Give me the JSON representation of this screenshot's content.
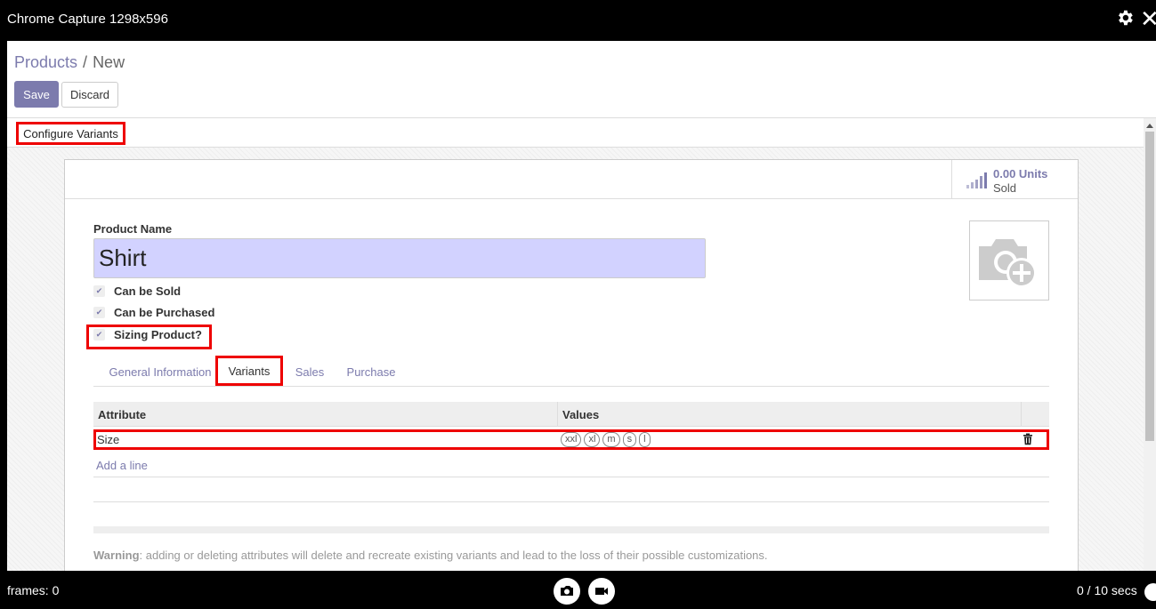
{
  "window": {
    "title": "Chrome Capture 1298x596"
  },
  "breadcrumb": {
    "parent": "Products",
    "separator": "/",
    "current": "New"
  },
  "control_panel": {
    "save_label": "Save",
    "discard_label": "Discard"
  },
  "status_bar": {
    "configure_variants_label": "Configure Variants"
  },
  "stat_button": {
    "value": "0.00 Units",
    "label": "Sold"
  },
  "form": {
    "product_name_label": "Product Name",
    "product_name_value": "Shirt",
    "checkboxes": [
      {
        "label": "Can be Sold",
        "checked": true
      },
      {
        "label": "Can be Purchased",
        "checked": true
      },
      {
        "label": "Sizing Product?",
        "checked": true
      }
    ]
  },
  "tabs": [
    {
      "label": "General Information"
    },
    {
      "label": "Variants",
      "active": true
    },
    {
      "label": "Sales"
    },
    {
      "label": "Purchase"
    }
  ],
  "variants_table": {
    "headers": [
      "Attribute",
      "Values"
    ],
    "rows": [
      {
        "attribute": "Size",
        "values": [
          "xxl",
          "xl",
          "m",
          "s",
          "l"
        ]
      }
    ],
    "add_line_label": "Add a line"
  },
  "warning": {
    "bold": "Warning",
    "text": ": adding or deleting attributes will delete and recreate existing variants and lead to the loss of their possible customizations."
  },
  "footer": {
    "frames": "frames: 0",
    "secs": "0 / 10 secs"
  },
  "colors": {
    "accent": "#7c7bad",
    "highlight": "#e00000",
    "input_bg": "#d2d2ff"
  },
  "icons": {
    "settings": "gear-icon",
    "close": "close-icon",
    "camera": "camera-icon",
    "video": "video-icon",
    "trash": "trash-icon",
    "chart": "bar-chart-icon",
    "image": "camera-add-icon",
    "info": "info-icon"
  }
}
